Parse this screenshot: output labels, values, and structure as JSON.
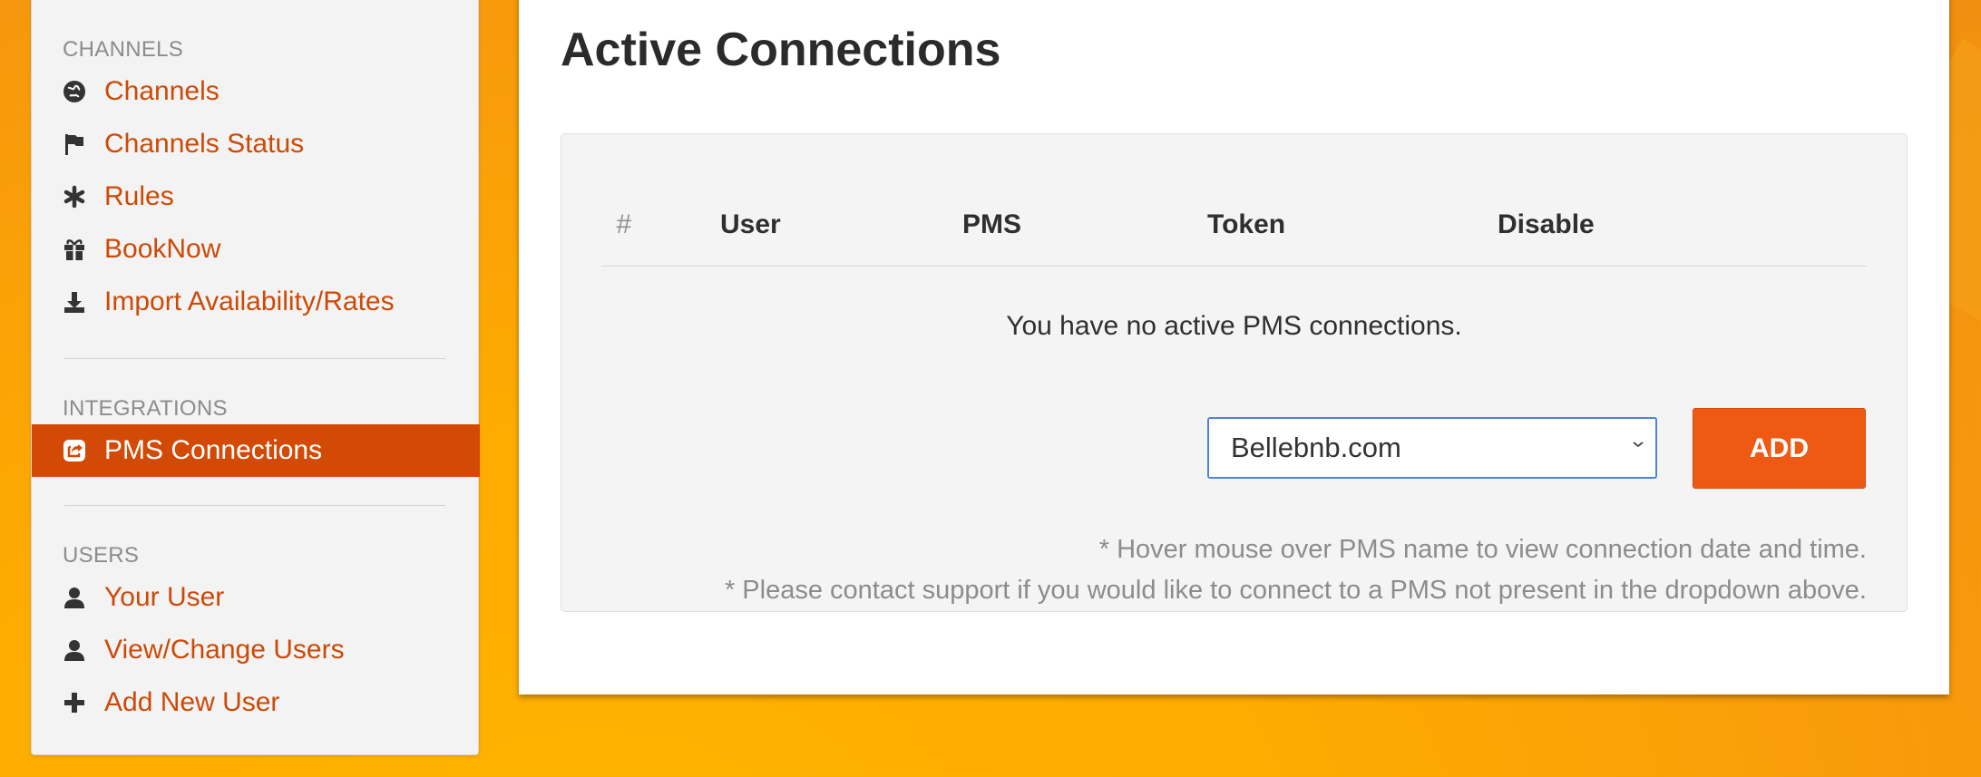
{
  "colors": {
    "accent": "#d24a05",
    "link": "#cc4a07",
    "button": "#ee5a14",
    "background": "#ffab00"
  },
  "sidebar": {
    "sections": [
      {
        "header": "CHANNELS",
        "items": [
          {
            "label": "Channels",
            "icon": "globe-icon"
          },
          {
            "label": "Channels Status",
            "icon": "flag-icon"
          },
          {
            "label": "Rules",
            "icon": "asterisk-icon"
          },
          {
            "label": "BookNow",
            "icon": "gift-icon"
          },
          {
            "label": "Import Availability/Rates",
            "icon": "download-icon"
          }
        ]
      },
      {
        "header": "INTEGRATIONS",
        "items": [
          {
            "label": "PMS Connections",
            "icon": "share-icon",
            "active": true
          }
        ]
      },
      {
        "header": "USERS",
        "items": [
          {
            "label": "Your User",
            "icon": "user-icon"
          },
          {
            "label": "View/Change Users",
            "icon": "user-icon"
          },
          {
            "label": "Add New User",
            "icon": "plus-icon"
          }
        ]
      }
    ]
  },
  "main": {
    "title": "Active Connections",
    "table": {
      "columns": [
        "#",
        "User",
        "PMS",
        "Token",
        "Disable"
      ],
      "empty_message": "You have no active PMS connections."
    },
    "pms_select": {
      "selected": "Bellebnb.com"
    },
    "add_label": "ADD",
    "notes": [
      "* Hover mouse over PMS name to view connection date and time.",
      "* Please contact support if you would like to connect to a PMS not present in the dropdown above."
    ]
  }
}
